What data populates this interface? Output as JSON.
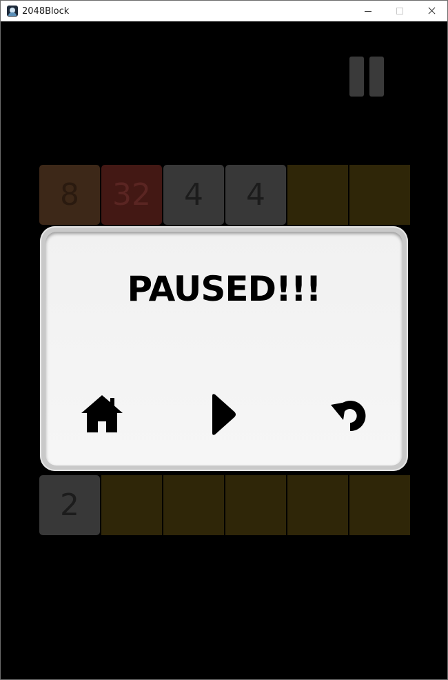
{
  "window": {
    "title": "2048Block"
  },
  "board": {
    "cells": [
      {
        "row": 0,
        "col": 0,
        "value": "8",
        "kind": "t8"
      },
      {
        "row": 0,
        "col": 1,
        "value": "32",
        "kind": "t32"
      },
      {
        "row": 0,
        "col": 2,
        "value": "4",
        "kind": "t4"
      },
      {
        "row": 0,
        "col": 3,
        "value": "4",
        "kind": "t4"
      },
      {
        "row": 0,
        "col": 4,
        "value": "",
        "kind": "empty"
      },
      {
        "row": 0,
        "col": 5,
        "value": "",
        "kind": "empty"
      },
      {
        "row": 5,
        "col": 0,
        "value": "2",
        "kind": "t2"
      },
      {
        "row": 5,
        "col": 1,
        "value": "",
        "kind": "empty"
      },
      {
        "row": 5,
        "col": 2,
        "value": "",
        "kind": "empty"
      },
      {
        "row": 5,
        "col": 3,
        "value": "",
        "kind": "empty"
      },
      {
        "row": 5,
        "col": 4,
        "value": "",
        "kind": "empty"
      },
      {
        "row": 5,
        "col": 5,
        "value": "",
        "kind": "empty"
      }
    ]
  },
  "pause_dialog": {
    "title": "PAUSED!!!",
    "buttons": {
      "home_icon": "home-icon",
      "play_icon": "play-icon",
      "restart_icon": "restart-icon"
    }
  },
  "colors": {
    "empty_cell": "#2f2608",
    "tile_8": "#3d2818",
    "tile_32": "#431814",
    "tile_gray": "#383838",
    "pause_button": "#3a3a3a"
  }
}
